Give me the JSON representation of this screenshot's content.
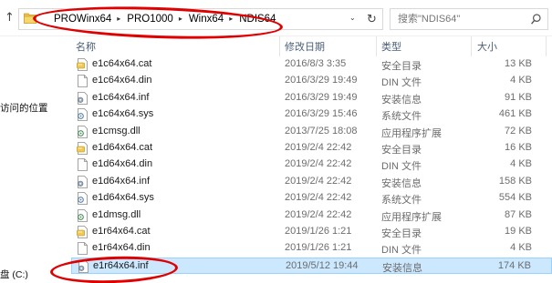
{
  "address_bar": {
    "up_glyph": "↑",
    "breadcrumbs": [
      "PROWinx64",
      "PRO1000",
      "Winx64",
      "NDIS64"
    ],
    "separator_glyph": "▸",
    "dropdown_glyph": "⌄",
    "refresh_glyph": "↻",
    "search_placeholder": "搜索\"NDIS64\""
  },
  "sidebar": {
    "items": [
      {
        "label": "访问的位置"
      },
      {
        "label": "盘 (C:)"
      }
    ]
  },
  "columns": {
    "name": "名称",
    "date": "修改日期",
    "type": "类型",
    "size": "大小"
  },
  "files": [
    {
      "name": "e1c64x64.cat",
      "date": "2016/8/3 3:35",
      "type": "安全目录",
      "size": "13 KB",
      "icon": "cat-file-icon"
    },
    {
      "name": "e1c64x64.din",
      "date": "2016/3/29 19:49",
      "type": "DIN 文件",
      "size": "4 KB",
      "icon": "blank-file-icon"
    },
    {
      "name": "e1c64x64.inf",
      "date": "2016/3/29 19:49",
      "type": "安装信息",
      "size": "91 KB",
      "icon": "inf-file-icon"
    },
    {
      "name": "e1c64x64.sys",
      "date": "2016/3/29 15:46",
      "type": "系统文件",
      "size": "461 KB",
      "icon": "sys-file-icon"
    },
    {
      "name": "e1cmsg.dll",
      "date": "2013/7/25 18:08",
      "type": "应用程序扩展",
      "size": "72 KB",
      "icon": "dll-file-icon"
    },
    {
      "name": "e1d64x64.cat",
      "date": "2019/2/4 22:42",
      "type": "安全目录",
      "size": "16 KB",
      "icon": "cat-file-icon"
    },
    {
      "name": "e1d64x64.din",
      "date": "2019/2/4 22:42",
      "type": "DIN 文件",
      "size": "4 KB",
      "icon": "blank-file-icon"
    },
    {
      "name": "e1d64x64.inf",
      "date": "2019/2/4 22:42",
      "type": "安装信息",
      "size": "158 KB",
      "icon": "inf-file-icon"
    },
    {
      "name": "e1d64x64.sys",
      "date": "2019/2/4 22:42",
      "type": "系统文件",
      "size": "554 KB",
      "icon": "sys-file-icon"
    },
    {
      "name": "e1dmsg.dll",
      "date": "2019/2/4 22:42",
      "type": "应用程序扩展",
      "size": "87 KB",
      "icon": "dll-file-icon"
    },
    {
      "name": "e1r64x64.cat",
      "date": "2019/1/26 1:21",
      "type": "安全目录",
      "size": "19 KB",
      "icon": "cat-file-icon"
    },
    {
      "name": "e1r64x64.din",
      "date": "2019/1/26 1:21",
      "type": "DIN 文件",
      "size": "4 KB",
      "icon": "blank-file-icon"
    },
    {
      "name": "e1r64x64.inf",
      "date": "2019/5/12 19:44",
      "type": "安装信息",
      "size": "174 KB",
      "icon": "inf-file-icon",
      "selected": true
    }
  ],
  "colors": {
    "selection_bg": "#cce8ff",
    "selection_border": "#99d1ff",
    "header_text": "#4c607a",
    "annotation_red": "#e00000"
  }
}
